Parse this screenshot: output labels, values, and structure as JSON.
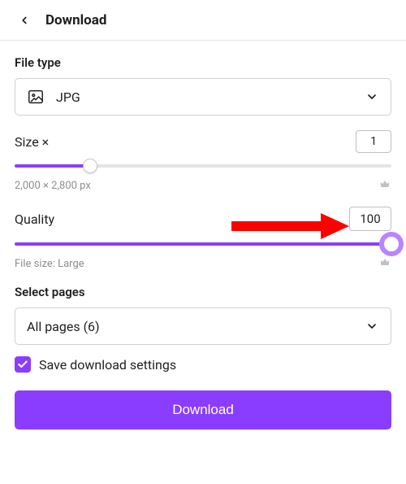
{
  "header": {
    "title": "Download"
  },
  "file_type": {
    "label": "File type",
    "value": "JPG"
  },
  "size": {
    "label": "Size ×",
    "value": "1",
    "slider_pct": 20,
    "dimensions": "2,000 × 2,800 px"
  },
  "quality": {
    "label": "Quality",
    "value": "100",
    "slider_pct": 100,
    "file_size": "File size: Large"
  },
  "select_pages": {
    "label": "Select pages",
    "value": "All pages (6)"
  },
  "save_settings": {
    "label": "Save download settings",
    "checked": true
  },
  "download_button": "Download"
}
